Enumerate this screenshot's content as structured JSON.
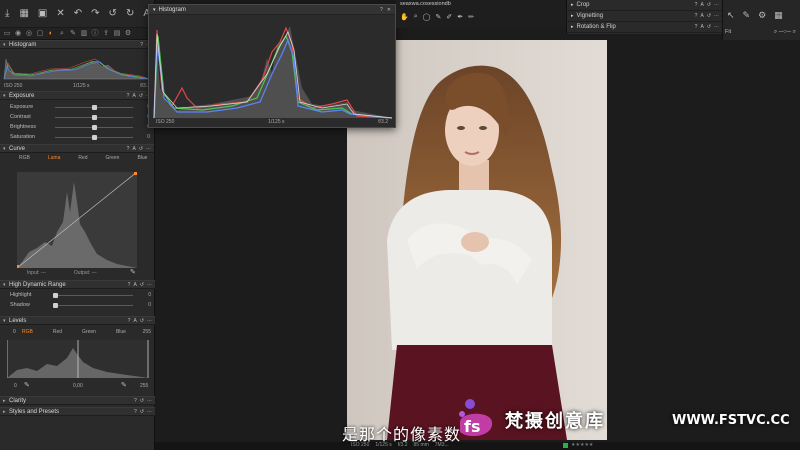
{
  "left_panel": {
    "histogram": {
      "title": "Histogram",
      "iso": "ISO 250",
      "shutter": "1/125 s",
      "aperture": "f/3.2"
    },
    "exposure": {
      "title": "Exposure",
      "sliders": [
        {
          "label": "Exposure",
          "value": "0",
          "knob": 0.5
        },
        {
          "label": "Contrast",
          "value": "0",
          "knob": 0.5
        },
        {
          "label": "Brightness",
          "value": "0",
          "knob": 0.5
        },
        {
          "label": "Saturation",
          "value": "0",
          "knob": 0.5
        }
      ]
    },
    "curve": {
      "title": "Curve",
      "tabs": [
        "RGB",
        "Luma",
        "Red",
        "Green",
        "Blue"
      ],
      "selected_tab": "Luma",
      "input_label": "Input:",
      "input_value": "---",
      "output_label": "Output:",
      "output_value": "---"
    },
    "hdr": {
      "title": "High Dynamic Range",
      "sliders": [
        {
          "label": "Highlight",
          "value": "0",
          "knob": 0.0
        },
        {
          "label": "Shadow",
          "value": "0",
          "knob": 0.0
        }
      ]
    },
    "levels": {
      "title": "Levels",
      "low": "0",
      "high": "255",
      "tabs": [
        "RGB",
        "Red",
        "Green",
        "Blue"
      ],
      "selected_tab": "RGB",
      "out_low": "0",
      "mid": "0,00",
      "out_high": "255"
    },
    "clarity": {
      "title": "Clarity"
    },
    "styles": {
      "title": "Styles and Presets"
    }
  },
  "hist_window": {
    "title": "Histogram",
    "iso": "ISO 250",
    "shutter": "1/125 s",
    "aperture": "f/3.2"
  },
  "top_bar": {
    "doc_title": "seaxwa.cosessiondb"
  },
  "right_tools": [
    {
      "label": "Crop"
    },
    {
      "label": "Vignetting"
    },
    {
      "label": "Rotation & Flip"
    }
  ],
  "far_right": {
    "fit_label": "Fit"
  },
  "bottom_strip": {
    "iso": "ISO 250",
    "shutter": "1/125 s",
    "aperture": "f/3.2",
    "focal": "85 mm",
    "file": "7M3..."
  },
  "subtitle": "是那个的像素数",
  "watermark": {
    "brand": "梵摄创意库",
    "url": "WWW.FSTVC.CC"
  },
  "colors": {
    "accent_orange": "#ff8a2a",
    "panel_bg": "#2a2a2a",
    "viewer_bg": "#1c1c1c"
  }
}
